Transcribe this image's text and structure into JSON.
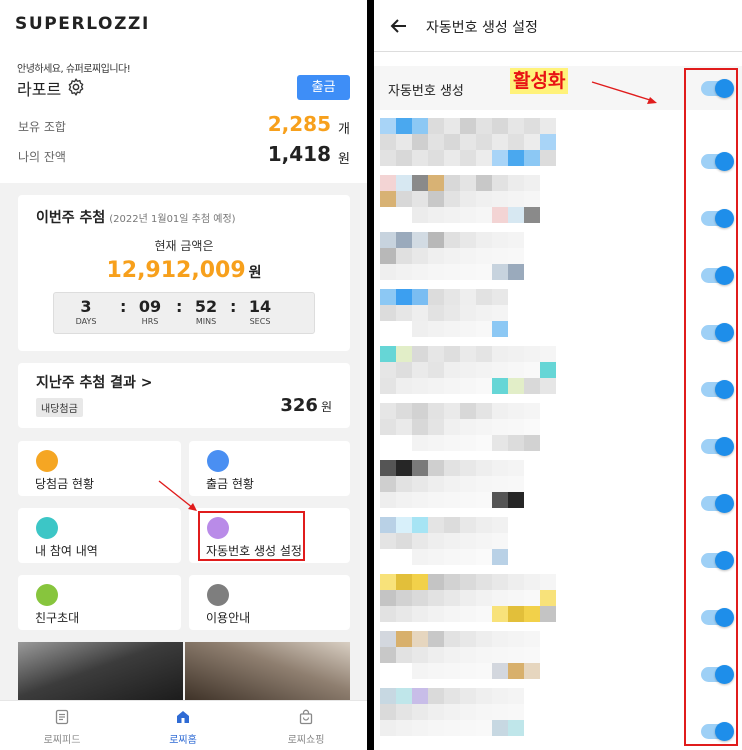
{
  "left": {
    "logo": "SUPERLOZZI",
    "greeting": "안녕하세요, 슈퍼로찌입니다!",
    "user_name": "라포르",
    "withdraw_button": "출금",
    "holdings_label": "보유 조합",
    "holdings_value": "2,285",
    "holdings_unit": "개",
    "balance_label": "나의 잔액",
    "balance_value": "1,418",
    "balance_unit": "원",
    "this_week": {
      "title": "이번주 추첨",
      "subtitle": "(2022년 1월01일 추첨 예정)",
      "current_label": "현재 금액은",
      "current_value": "12,912,009",
      "current_unit": "원",
      "countdown": [
        {
          "value": "3",
          "label": "DAYS"
        },
        {
          "value": "09",
          "label": "HRS"
        },
        {
          "value": "52",
          "label": "MINS"
        },
        {
          "value": "14",
          "label": "SECS"
        }
      ],
      "colon": ":"
    },
    "last_week": {
      "title": "지난주 추첨 결과 >",
      "badge": "내당첨금",
      "value": "326",
      "unit": "원"
    },
    "menu": [
      {
        "label": "당첨금 현황",
        "icon": "prize-box-icon",
        "color": "#f5a623"
      },
      {
        "label": "출금 현황",
        "icon": "withdraw-box-icon",
        "color": "#4a8ff2"
      },
      {
        "label": "내 참여 내역",
        "icon": "history-card-icon",
        "color": "#3cc6c6"
      },
      {
        "label": "자동번호 생성 설정",
        "icon": "dice-icon",
        "color": "#b98be8"
      },
      {
        "label": "친구초대",
        "icon": "invite-user-icon",
        "color": "#87c53d"
      },
      {
        "label": "이용안내",
        "icon": "warning-icon",
        "color": "#7e7e7e"
      }
    ],
    "tabs": [
      {
        "label": "로찌피드",
        "icon": "feed-icon"
      },
      {
        "label": "로찌홈",
        "icon": "home-icon"
      },
      {
        "label": "로찌쇼핑",
        "icon": "shopping-bag-icon"
      }
    ],
    "accent_color": "#f7a01c",
    "primary_color": "#3e8ef7",
    "highlight_color": "#e01c1c"
  },
  "right": {
    "title": "자동번호 생성 설정",
    "main_toggle_label": "자동번호 생성",
    "main_toggle_on": true,
    "annotation": "활성화",
    "item_toggles_on": [
      true,
      true,
      true,
      true,
      true,
      true,
      true,
      true,
      true,
      true,
      true
    ],
    "toggle_color": "#1e8eea"
  }
}
